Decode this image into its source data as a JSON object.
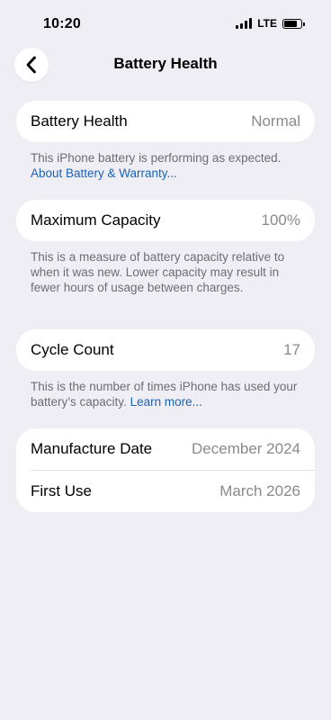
{
  "status_bar": {
    "time": "10:20",
    "network": "LTE",
    "signal_bars": 4,
    "battery_icon": "battery-icon",
    "battery_level": 0.85
  },
  "nav": {
    "back_icon": "chevron-left-icon",
    "title": "Battery Health"
  },
  "sections": {
    "battery_health": {
      "label": "Battery Health",
      "value": "Normal",
      "footnote": "This iPhone battery is performing as expected.",
      "link": "About Battery & Warranty..."
    },
    "maximum_capacity": {
      "label": "Maximum Capacity",
      "value": "100%",
      "footnote": "This is a measure of battery capacity relative to when it was new. Lower capacity may result in fewer hours of usage between charges."
    },
    "cycle_count": {
      "label": "Cycle Count",
      "value": "17",
      "footnote": "This is the number of times iPhone has used your battery’s capacity.",
      "link": "Learn more..."
    },
    "dates": {
      "manufacture_label": "Manufacture Date",
      "manufacture_value": "December 2024",
      "first_use_label": "First Use",
      "first_use_value": "March 2026"
    }
  },
  "colors": {
    "background": "#efeef4",
    "card": "#ffffff",
    "link": "#1a63b8",
    "secondary_text": "#8a8a8e"
  }
}
